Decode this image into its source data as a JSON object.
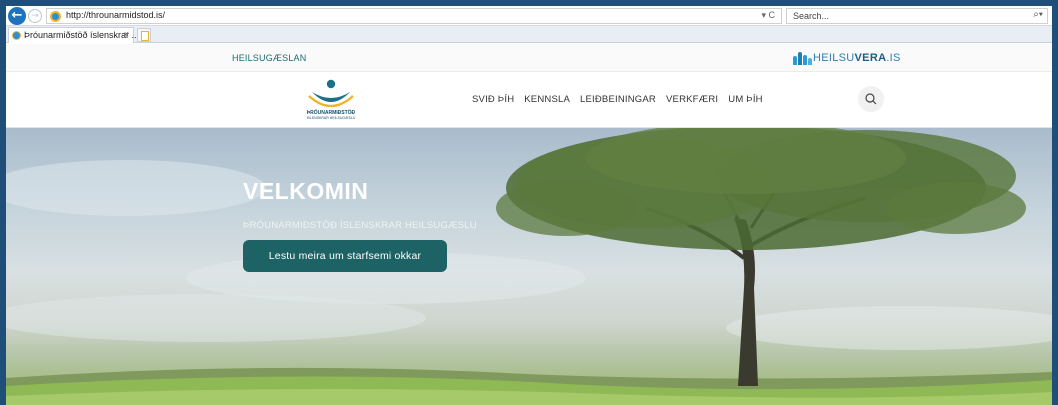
{
  "browser": {
    "url": "http://throunarmidstod.is/",
    "search_placeholder": "Search...",
    "url_actions": "▾ C",
    "tab_title": "Þróunarmiðstöð íslenskrar ...",
    "tab_close": "×"
  },
  "site": {
    "top_link": "HEILSUGÆSLAN",
    "partner_logo": {
      "part1": "HEILSU",
      "part2": "VERA",
      "part3": ".IS"
    },
    "logo_lines": [
      "ÞRÓUNARMIÐSTÖÐ",
      "ÍSLENSKRAR HEILSUGÆSLU"
    ],
    "menu": [
      "SVIÐ ÞÍH",
      "KENNSLA",
      "LEIÐBEININGAR",
      "VERKFÆRI",
      "UM ÞÍH"
    ]
  },
  "hero": {
    "title": "VELKOMIN",
    "subtitle": "ÞRÓUNARMIÐSTÖÐ ÍSLENSKRAR HEILSUGÆSLU",
    "button_label": "Lestu meira um starfsemi okkar"
  },
  "colors": {
    "brand_teal": "#1d6265",
    "link_teal": "#1a6b6e",
    "window_frame": "#1f4e79"
  }
}
